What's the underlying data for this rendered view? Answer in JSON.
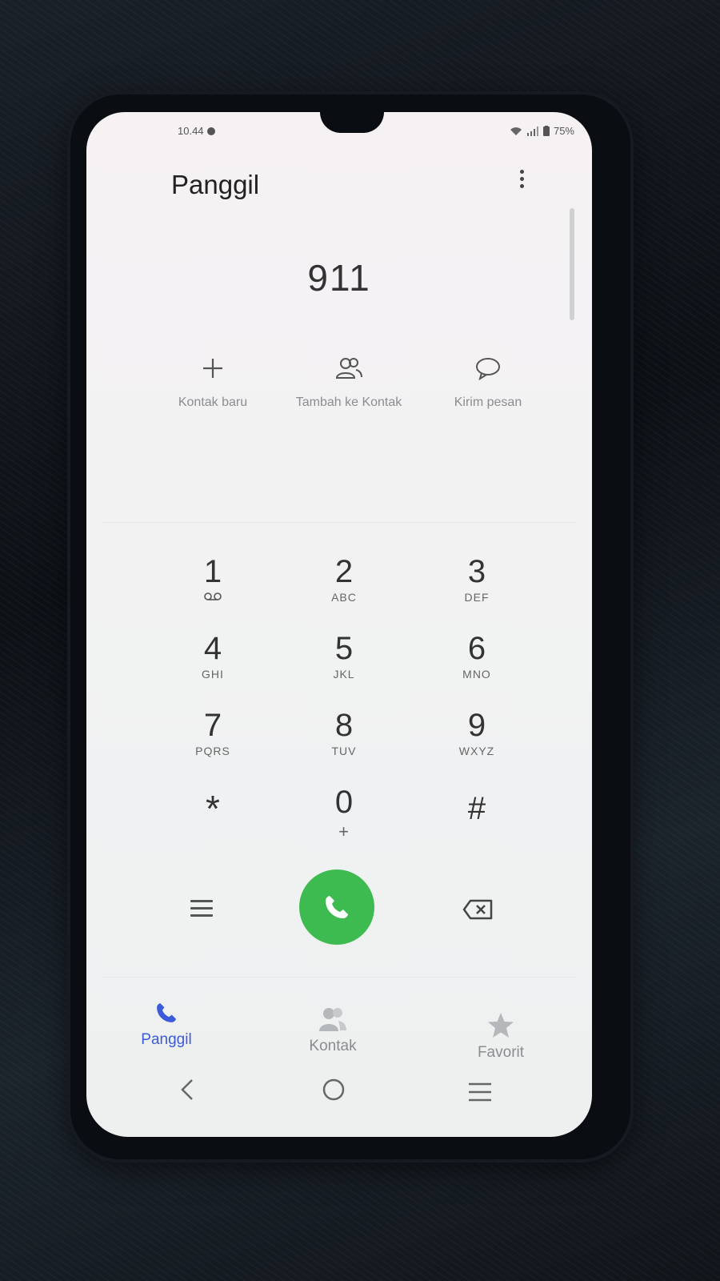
{
  "status_bar": {
    "time": "10.44",
    "battery": "75%"
  },
  "header": {
    "title": "Panggil"
  },
  "dialer": {
    "number": "911"
  },
  "actions": [
    {
      "label": "Kontak baru",
      "icon": "plus-icon"
    },
    {
      "label": "Tambah ke Kontak",
      "icon": "contacts-icon"
    },
    {
      "label": "Kirim pesan",
      "icon": "message-icon"
    }
  ],
  "keypad": [
    {
      "digit": "1",
      "letters": ""
    },
    {
      "digit": "2",
      "letters": "ABC"
    },
    {
      "digit": "3",
      "letters": "DEF"
    },
    {
      "digit": "4",
      "letters": "GHI"
    },
    {
      "digit": "5",
      "letters": "JKL"
    },
    {
      "digit": "6",
      "letters": "MNO"
    },
    {
      "digit": "7",
      "letters": "PQRS"
    },
    {
      "digit": "8",
      "letters": "TUV"
    },
    {
      "digit": "9",
      "letters": "WXYZ"
    },
    {
      "digit": "*",
      "letters": ""
    },
    {
      "digit": "0",
      "letters": "+"
    },
    {
      "digit": "#",
      "letters": ""
    }
  ],
  "tabs": [
    {
      "label": "Panggil",
      "active": true
    },
    {
      "label": "Kontak",
      "active": false
    },
    {
      "label": "Favorit",
      "active": false
    }
  ],
  "colors": {
    "call_green": "#3dbb50",
    "active_tab": "#3b5bdb",
    "inactive_tab": "#8a8d90"
  }
}
